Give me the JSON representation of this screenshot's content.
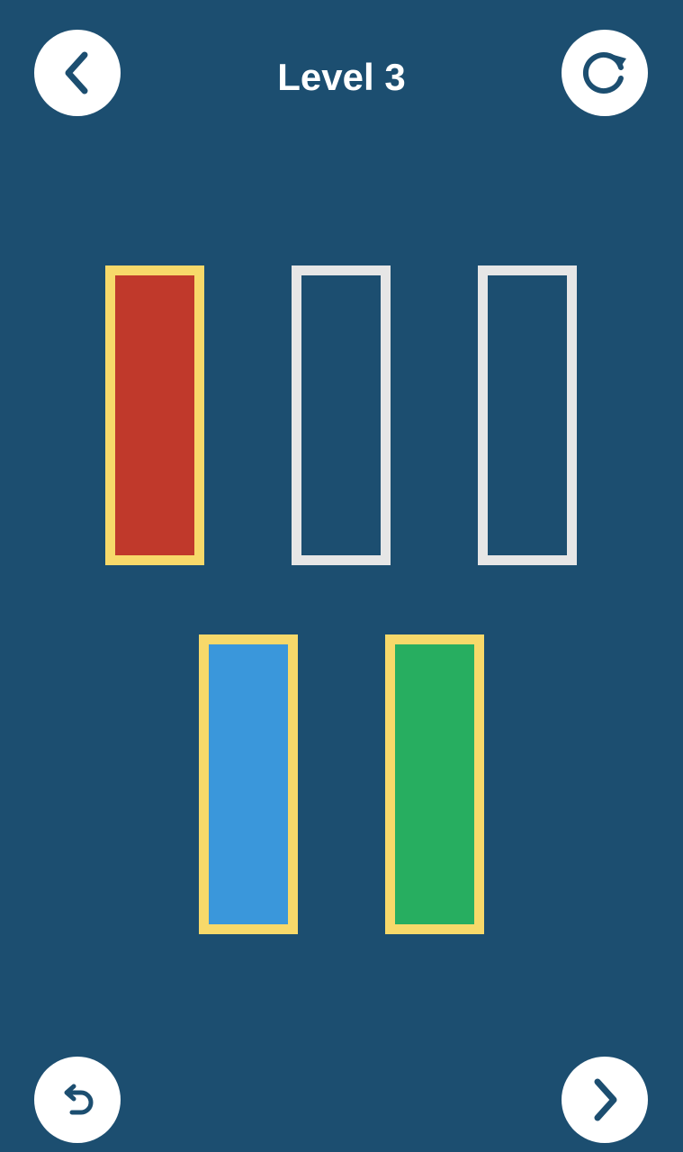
{
  "header": {
    "title": "Level 3",
    "back_icon": "chevron-left-icon",
    "restart_icon": "restart-icon"
  },
  "footer": {
    "undo_icon": "undo-icon",
    "next_icon": "chevron-right-icon"
  },
  "colors": {
    "background": "#1c4e70",
    "button": "#ffffff",
    "icon": "#1c4e70",
    "tube_empty_border": "#e6e6e6",
    "tube_filled_border": "#f7d96a"
  },
  "tubes": [
    {
      "fill_color": "#c0392b",
      "fill_level": 1.0
    },
    {
      "fill_color": null,
      "fill_level": 0
    },
    {
      "fill_color": null,
      "fill_level": 0
    },
    {
      "fill_color": "#3a97db",
      "fill_level": 1.0
    },
    {
      "fill_color": "#27ae60",
      "fill_level": 1.0
    }
  ]
}
